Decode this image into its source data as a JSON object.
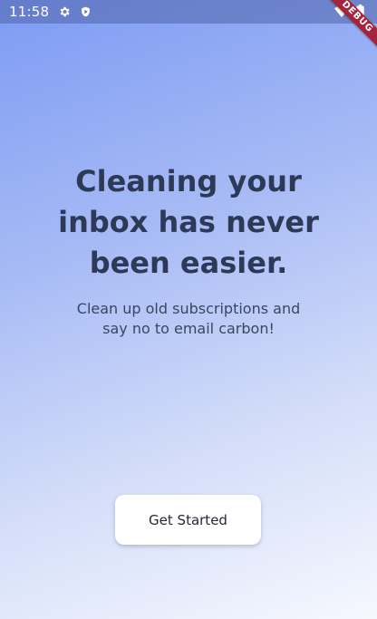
{
  "status_bar": {
    "time": "11:58",
    "icons": [
      "settings-icon",
      "shield-icon",
      "wifi-icon",
      "battery-icon"
    ]
  },
  "debug_banner": {
    "label": "DEBUG",
    "color": "#a3243b"
  },
  "hero": {
    "headline_lines": [
      "Cleaning your",
      "inbox has never",
      "been easier."
    ],
    "subtitle_lines": [
      "Clean up old subscriptions and",
      "say no to email carbon!"
    ]
  },
  "actions": {
    "get_started_label": "Get Started"
  },
  "theme": {
    "gradient_start": "#7d9bf3",
    "gradient_end": "#f6f8fe",
    "headline_color": "#2c3a57",
    "button_bg": "#ffffff"
  }
}
